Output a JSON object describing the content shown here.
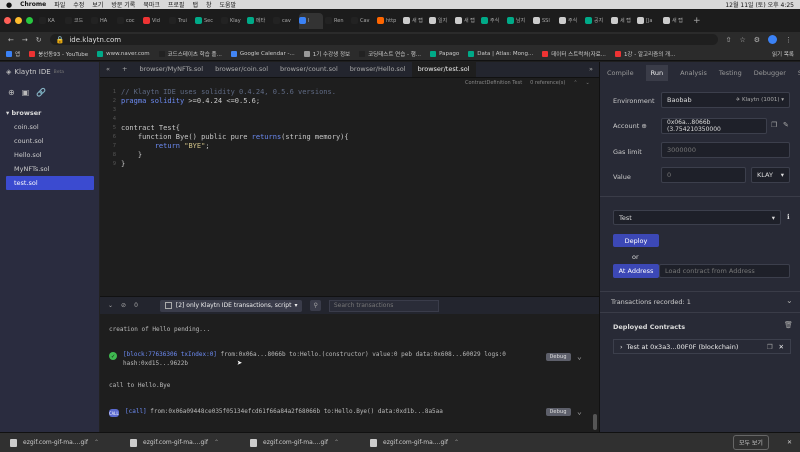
{
  "menubar": {
    "apple": "",
    "app": "Chrome",
    "items": [
      "파일",
      "수정",
      "보기",
      "방문 기록",
      "북마크",
      "프로필",
      "탭",
      "창",
      "도움말"
    ],
    "clock": "12월 11일 (토) 오후 4:25"
  },
  "browser_tabs": [
    {
      "label": "KA",
      "color": "#222"
    },
    {
      "label": "코드",
      "color": "#222"
    },
    {
      "label": "HA",
      "color": "#222"
    },
    {
      "label": "coc",
      "color": "#222"
    },
    {
      "label": "Vid",
      "color": "#e33"
    },
    {
      "label": "Trui",
      "color": "#222"
    },
    {
      "label": "Sec",
      "color": "#0a8"
    },
    {
      "label": "Klay",
      "color": "#222"
    },
    {
      "label": "메타",
      "color": "#0a8"
    },
    {
      "label": "cav",
      "color": "#222"
    },
    {
      "label": "I",
      "color": "#3b82f6"
    },
    {
      "label": "Ren",
      "color": "#222"
    },
    {
      "label": "Cav",
      "color": "#222"
    },
    {
      "label": "http",
      "color": "#f60"
    },
    {
      "label": "새 탭",
      "color": "#ccc"
    },
    {
      "label": "일지",
      "color": "#ccc"
    },
    {
      "label": "새 탭",
      "color": "#ccc"
    },
    {
      "label": "주식",
      "color": "#0a8"
    },
    {
      "label": "남지",
      "color": "#0a8"
    },
    {
      "label": "SSI",
      "color": "#ccc"
    },
    {
      "label": "주식",
      "color": "#ccc"
    },
    {
      "label": "공지",
      "color": "#0a8"
    },
    {
      "label": "세 탭",
      "color": "#ccc"
    },
    {
      "label": "[Ja",
      "color": "#ccc"
    },
    {
      "label": "새 탭",
      "color": "#ccc"
    }
  ],
  "address": {
    "url": "ide.klaytn.com"
  },
  "bookmarks": [
    {
      "label": "앱",
      "color": "#3b82f6"
    },
    {
      "label": "붕선동93 - YouTube",
      "color": "#e33"
    },
    {
      "label": "www.naver.com",
      "color": "#0a8"
    },
    {
      "label": "코드스테이츠 학습 플...",
      "color": "#222"
    },
    {
      "label": "Google Calendar -...",
      "color": "#4285f4"
    },
    {
      "label": "1기 수강생 정보",
      "color": "#999"
    },
    {
      "label": "코딩테스트 연습 - 행...",
      "color": "#222"
    },
    {
      "label": "Papago",
      "color": "#0a8"
    },
    {
      "label": "Data | Atlas: Mong...",
      "color": "#0a8"
    },
    {
      "label": "데이터 스트럭처(자료...",
      "color": "#e33"
    },
    {
      "label": "1강 - 알고리즘의 개...",
      "color": "#e33"
    }
  ],
  "bookmarks_right": "읽기 목록",
  "sidebar": {
    "logo": "Klaytn IDE",
    "logo_badge": "Beta",
    "tree_root": "browser",
    "files": [
      "coin.sol",
      "count.sol",
      "Hello.sol",
      "MyNFTs.sol",
      "test.sol"
    ],
    "selected": "test.sol"
  },
  "editor_tabs": [
    "browser/MyNFTs.sol",
    "browser/coin.sol",
    "browser/count.sol",
    "browser/Hello.sol",
    "browser/test.sol"
  ],
  "active_editor_tab": "browser/test.sol",
  "contract_bar": {
    "definition": "ContractDefinition Test",
    "refs": "0 reference(s)"
  },
  "code": [
    {
      "n": "1",
      "parts": [
        {
          "c": "cm",
          "t": "// Klaytn IDE uses solidity 0.4.24, 0.5.6 versions."
        }
      ]
    },
    {
      "n": "2",
      "parts": [
        {
          "c": "kw",
          "t": "pragma solidity"
        },
        {
          "c": "tx",
          "t": " >=0.4.24 <=0.5.6;"
        }
      ]
    },
    {
      "n": "3",
      "parts": []
    },
    {
      "n": "4",
      "parts": []
    },
    {
      "n": "5",
      "parts": [
        {
          "c": "tx",
          "t": "contract Test{"
        }
      ]
    },
    {
      "n": "6",
      "parts": [
        {
          "c": "tx",
          "t": "    function Bye() public pure "
        },
        {
          "c": "kw",
          "t": "returns"
        },
        {
          "c": "tx",
          "t": "(string memory){"
        }
      ]
    },
    {
      "n": "7",
      "parts": [
        {
          "c": "tx",
          "t": "        "
        },
        {
          "c": "kw",
          "t": "return"
        },
        {
          "c": "st",
          "t": " \"BYE\""
        },
        {
          "c": "tx",
          "t": ";"
        }
      ]
    },
    {
      "n": "8",
      "parts": [
        {
          "c": "tx",
          "t": "    }"
        }
      ]
    },
    {
      "n": "9",
      "parts": [
        {
          "c": "tx",
          "t": "}"
        }
      ]
    }
  ],
  "terminal_bar": {
    "count": "0",
    "filter": "[2] only Klaytn IDE transactions, script",
    "search_placeholder": "Search transactions"
  },
  "terminal": {
    "pending": "creation of Hello pending...",
    "tx1_line1_tag": "[block:77636306 txIndex:0]",
    "tx1_line1_rest": " from:0x06a...8066b to:Hello.(constructor) value:0 peb data:0x608...60029 logs:0",
    "tx1_line2": "hash:0xd15...9622b",
    "call_label": "call to Hello.Bye",
    "call_badge": "CALL",
    "tx2_tag": "[call]",
    "tx2_rest": " from:0x06a09448ce035f05134efcd61f66a84a2f68066b to:Hello.Bye() data:0xd1b...8a5aa",
    "debug": "Debug"
  },
  "right_tabs": [
    "Compile",
    "Run",
    "Analysis",
    "Testing",
    "Debugger",
    "Settings"
  ],
  "active_right_tab": "Run",
  "run": {
    "env_label": "Environment",
    "env_value": "Baobab",
    "env_network": "Klaytn (1001)",
    "account_label": "Account",
    "account_value": "0x06a...8066b (3.754210350000",
    "gas_label": "Gas limit",
    "gas_value": "3000000",
    "value_label": "Value",
    "value_value": "0",
    "value_unit": "KLAY",
    "contract_select": "Test",
    "deploy": "Deploy",
    "or": "or",
    "at_address": "At Address",
    "at_address_placeholder": "Load contract from Address",
    "recorded": "Transactions recorded: 1",
    "deployed_title": "Deployed Contracts",
    "deployed_item": "Test at 0x3a3...00F0F (blockchain)"
  },
  "downloads": {
    "items": [
      "ezgif.com-gif-ma....gif",
      "ezgif.com-gif-ma....gif",
      "ezgif.com-gif-ma....gif",
      "ezgif.com-gif-ma....gif"
    ],
    "show_all": "모두 보기"
  }
}
